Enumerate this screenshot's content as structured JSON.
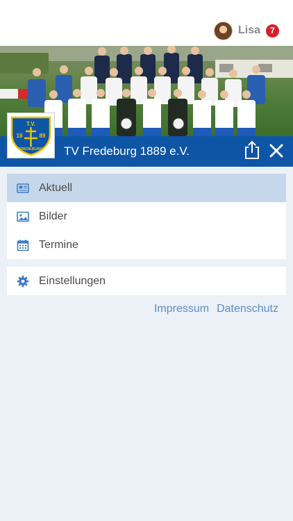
{
  "user": {
    "name": "Lisa",
    "notification_count": "7"
  },
  "club": {
    "name": "TV Fredeburg 1889 e.V.",
    "logo_text_top": "T.V.",
    "logo_year_left": "18",
    "logo_year_right": "89",
    "logo_text_bottom": "FREDEBURG"
  },
  "menu": {
    "items": [
      {
        "label": "Aktuell",
        "icon": "newspaper-icon",
        "active": true
      },
      {
        "label": "Bilder",
        "icon": "image-icon",
        "active": false
      },
      {
        "label": "Termine",
        "icon": "calendar-icon",
        "active": false
      }
    ],
    "settings": {
      "label": "Einstellungen",
      "icon": "gear-icon"
    }
  },
  "footer": {
    "impressum": "Impressum",
    "datenschutz": "Datenschutz"
  },
  "colors": {
    "brand_blue": "#0f55a6",
    "active_item": "#c5d7ea",
    "background": "#ecf0f7",
    "link": "#5a8fc6",
    "badge": "#d8202a"
  }
}
